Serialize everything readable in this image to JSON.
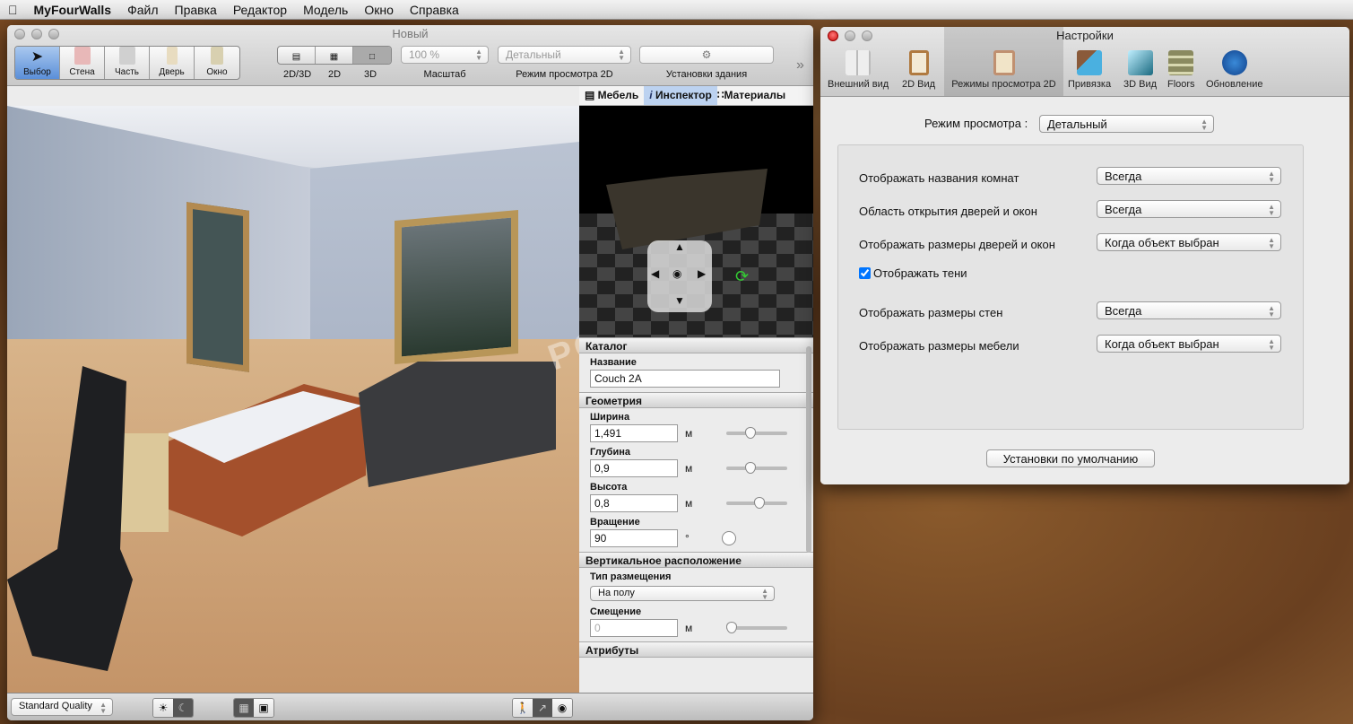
{
  "menubar": {
    "app": "MyFourWalls",
    "items": [
      "Файл",
      "Правка",
      "Редактор",
      "Модель",
      "Окно",
      "Справка"
    ]
  },
  "main": {
    "title": "Новый",
    "tools": [
      {
        "label": "Выбор",
        "color": "#ffffff"
      },
      {
        "label": "Стена",
        "color": "#e8b8b8"
      },
      {
        "label": "Часть",
        "color": "#d0d0d0"
      },
      {
        "label": "Дверь",
        "color": "#e8dcc0"
      },
      {
        "label": "Окно",
        "color": "#d8d0b0"
      }
    ],
    "view_modes": [
      "2D/3D",
      "2D",
      "3D"
    ],
    "zoom": {
      "value": "100 %",
      "label": "Масштаб"
    },
    "mode2d": {
      "value": "Детальный",
      "label": "Режим просмотра 2D"
    },
    "building_label": "Установки здания",
    "more": "»",
    "tabs": [
      "Мебель",
      "Инспектор",
      "Материалы"
    ],
    "inspector": {
      "catalog": "Каталог",
      "name_label": "Название",
      "name": "Couch 2A",
      "geometry": "Геометрия",
      "fields": [
        {
          "label": "Ширина",
          "value": "1,491",
          "unit": "м",
          "level": 0.3
        },
        {
          "label": "Глубина",
          "value": "0,9",
          "unit": "м",
          "level": 0.3
        },
        {
          "label": "Высота",
          "value": "0,8",
          "unit": "м",
          "level": 0.45
        }
      ],
      "rotation": {
        "label": "Вращение",
        "value": "90",
        "unit": "°"
      },
      "vertical": "Вертикальное расположение",
      "placement_label": "Тип размещения",
      "placement": "На полу",
      "offset_label": "Смещение",
      "offset": "0",
      "offset_unit": "м",
      "attributes": "Атрибуты"
    },
    "quality": "Standard Quality"
  },
  "watermark": "PORTAL",
  "settings": {
    "title": "Настройки",
    "toolbar": [
      {
        "label": "Внешний вид",
        "icon": "grid-icon"
      },
      {
        "label": "2D Вид",
        "icon": "plan-icon"
      },
      {
        "label": "Режимы просмотра 2D",
        "icon": "modes-icon"
      },
      {
        "label": "Привязка",
        "icon": "snap-icon"
      },
      {
        "label": "3D Вид",
        "icon": "cube-icon"
      },
      {
        "label": "Floors",
        "icon": "floors-icon"
      },
      {
        "label": "Обновление",
        "icon": "globe-icon"
      }
    ],
    "mode_label": "Режим просмотра :",
    "mode_value": "Детальный",
    "rows": [
      {
        "label": "Отображать названия комнат",
        "value": "Всегда"
      },
      {
        "label": "Область открытия дверей и окон",
        "value": "Всегда"
      },
      {
        "label": "Отображать размеры дверей и окон",
        "value": "Когда объект выбран"
      }
    ],
    "shadows": "Отображать тени",
    "rows2": [
      {
        "label": "Отображать размеры стен",
        "value": "Всегда"
      },
      {
        "label": "Отображать размеры мебели",
        "value": "Когда объект выбран"
      }
    ],
    "defaults": "Установки по умолчанию"
  }
}
